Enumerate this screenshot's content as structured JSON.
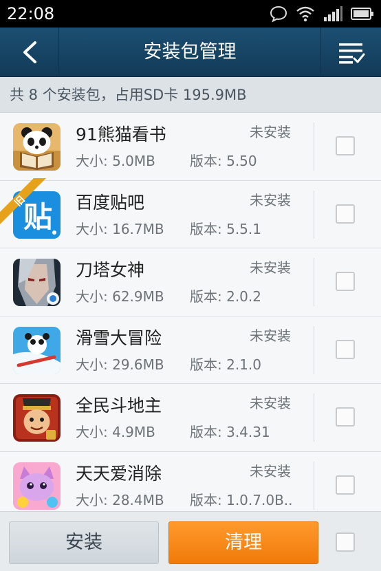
{
  "status_bar": {
    "time": "22:08"
  },
  "header": {
    "title": "安装包管理"
  },
  "summary": {
    "text": "共 8 个安装包，占用SD卡 195.9MB"
  },
  "apps": [
    {
      "name": "91熊猫看书",
      "size": "大小: 5.0MB",
      "version": "版本: 5.50",
      "status": "未安装",
      "icon": "panda-reader-icon"
    },
    {
      "name": "百度贴吧",
      "size": "大小: 16.7MB",
      "version": "版本: 5.5.1",
      "status": "未安装",
      "icon": "baidu-tieba-icon",
      "badge": "旧"
    },
    {
      "name": "刀塔女神",
      "size": "大小: 62.9MB",
      "version": "版本: 2.0.2",
      "status": "未安装",
      "icon": "dota-goddess-icon"
    },
    {
      "name": "滑雪大冒险",
      "size": "大小: 29.6MB",
      "version": "版本: 2.1.0",
      "status": "未安装",
      "icon": "ski-safari-icon"
    },
    {
      "name": "全民斗地主",
      "size": "大小: 4.9MB",
      "version": "版本: 3.4.31",
      "status": "未安装",
      "icon": "doudizhu-icon"
    },
    {
      "name": "天天爱消除",
      "size": "大小: 28.4MB",
      "version": "版本: 1.0.7.0B..",
      "status": "未安装",
      "icon": "tiantian-xiaochu-icon"
    }
  ],
  "footer": {
    "install_label": "安装",
    "clean_label": "清理"
  },
  "colors": {
    "header": "#1c4f72",
    "clean_button": "#f5820f",
    "tieba_blue": "#1a8fe0"
  }
}
